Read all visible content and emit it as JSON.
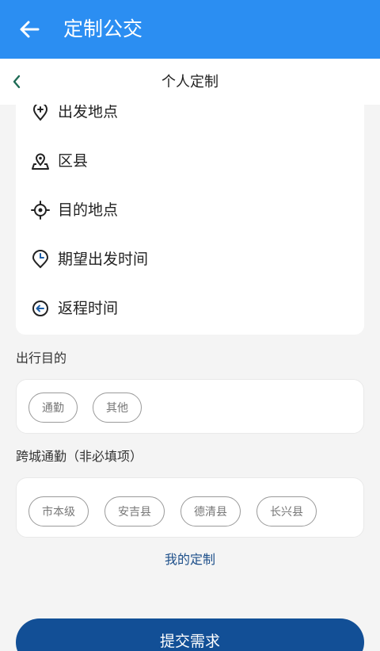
{
  "appbar": {
    "title": "定制公交",
    "back_icon": "arrow-left-icon"
  },
  "subbar": {
    "title": "个人定制",
    "back_icon": "chevron-left-icon"
  },
  "form_rows": [
    {
      "label": "出发地点",
      "icon": "location-pin-plus-icon"
    },
    {
      "label": "区县",
      "icon": "map-pin-icon"
    },
    {
      "label": "目的地点",
      "icon": "crosshair-icon"
    },
    {
      "label": "期望出发时间",
      "icon": "clock-icon"
    },
    {
      "label": "返程时间",
      "icon": "return-arrow-icon"
    }
  ],
  "purpose": {
    "title": "出行目的",
    "options": [
      "通勤",
      "其他"
    ]
  },
  "cross_city": {
    "title": "跨城通勤（非必填项）",
    "options": [
      "市本级",
      "安吉县",
      "德清县",
      "长兴县"
    ]
  },
  "my_custom_link": "我的定制",
  "submit_label": "提交需求",
  "colors": {
    "appbar": "#2b8ef2",
    "submit": "#124f96",
    "link": "#1d4f8a"
  }
}
